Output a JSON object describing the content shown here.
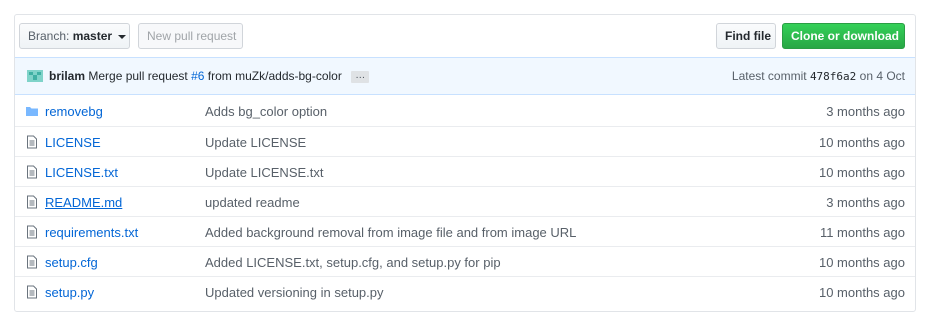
{
  "toolbar": {
    "branch_label": "Branch:",
    "branch_value": "master",
    "new_pr_label": "New pull request",
    "find_file_label": "Find file",
    "clone_label": "Clone or download"
  },
  "commit": {
    "author": "brilam",
    "message_prefix": "Merge pull request",
    "pr_number": "#6",
    "message_suffix": "from muZk/adds-bg-color",
    "ellipsis": "…",
    "latest_label": "Latest commit",
    "sha": "478f6a2",
    "date": "on 4 Oct"
  },
  "files": [
    {
      "icon": "folder-icon",
      "name": "removebg",
      "message": "Adds bg_color option",
      "age": "3 months ago"
    },
    {
      "icon": "file-icon",
      "name": "LICENSE",
      "message": "Update LICENSE",
      "age": "10 months ago"
    },
    {
      "icon": "file-icon",
      "name": "LICENSE.txt",
      "message": "Update LICENSE.txt",
      "age": "10 months ago"
    },
    {
      "icon": "file-icon",
      "name": "README.md",
      "message": "updated readme",
      "age": "3 months ago"
    },
    {
      "icon": "file-icon",
      "name": "requirements.txt",
      "message": "Added background removal from image file and from image URL",
      "age": "11 months ago"
    },
    {
      "icon": "file-icon",
      "name": "setup.cfg",
      "message": "Added LICENSE.txt, setup.cfg, and setup.py for pip",
      "age": "10 months ago"
    },
    {
      "icon": "file-icon",
      "name": "setup.py",
      "message": "Updated versioning in setup.py",
      "age": "10 months ago"
    }
  ]
}
